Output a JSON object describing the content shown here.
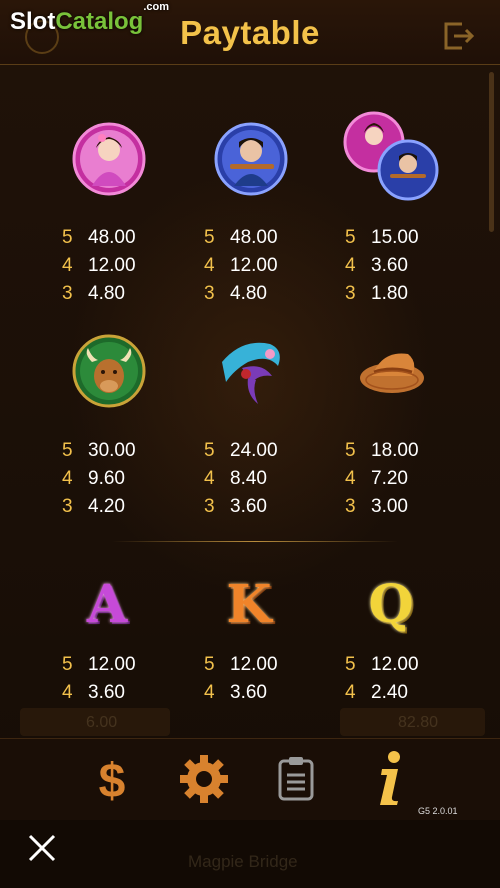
{
  "header": {
    "title": "Paytable",
    "logo_text": "Slot",
    "logo_accent": "Catalog",
    "logo_suffix": ".com"
  },
  "symbols": [
    {
      "name": "pink-lady-symbol",
      "payouts": [
        {
          "count": "5",
          "value": "48.00"
        },
        {
          "count": "4",
          "value": "12.00"
        },
        {
          "count": "3",
          "value": "4.80"
        }
      ]
    },
    {
      "name": "blue-man-symbol",
      "payouts": [
        {
          "count": "5",
          "value": "48.00"
        },
        {
          "count": "4",
          "value": "12.00"
        },
        {
          "count": "3",
          "value": "4.80"
        }
      ]
    },
    {
      "name": "couple-symbol",
      "payouts": [
        {
          "count": "5",
          "value": "15.00"
        },
        {
          "count": "4",
          "value": "3.60"
        },
        {
          "count": "3",
          "value": "1.80"
        }
      ]
    },
    {
      "name": "ox-symbol",
      "payouts": [
        {
          "count": "5",
          "value": "30.00"
        },
        {
          "count": "4",
          "value": "9.60"
        },
        {
          "count": "3",
          "value": "4.20"
        }
      ]
    },
    {
      "name": "scarf-symbol",
      "payouts": [
        {
          "count": "5",
          "value": "24.00"
        },
        {
          "count": "4",
          "value": "8.40"
        },
        {
          "count": "3",
          "value": "3.60"
        }
      ]
    },
    {
      "name": "straw-hat-symbol",
      "payouts": [
        {
          "count": "5",
          "value": "18.00"
        },
        {
          "count": "4",
          "value": "7.20"
        },
        {
          "count": "3",
          "value": "3.00"
        }
      ]
    },
    {
      "name": "letter-a-symbol",
      "glyph": "A",
      "payouts": [
        {
          "count": "5",
          "value": "12.00"
        },
        {
          "count": "4",
          "value": "3.60"
        }
      ]
    },
    {
      "name": "letter-k-symbol",
      "glyph": "K",
      "payouts": [
        {
          "count": "5",
          "value": "12.00"
        },
        {
          "count": "4",
          "value": "3.60"
        }
      ]
    },
    {
      "name": "letter-q-symbol",
      "glyph": "Q",
      "payouts": [
        {
          "count": "5",
          "value": "12.00"
        },
        {
          "count": "4",
          "value": "2.40"
        }
      ]
    }
  ],
  "background_text": {
    "bet_value": "6.00",
    "balance_value": "82.80",
    "game_name": "Magpie Bridge"
  },
  "toolbar": {
    "buttons": [
      "dollar-icon",
      "gear-icon",
      "clipboard-icon",
      "info-icon"
    ],
    "version": "G5 2.0.01"
  },
  "colors": {
    "accent": "#f3c24a",
    "background": "#1e1108",
    "count_color": "#f2c14c"
  }
}
